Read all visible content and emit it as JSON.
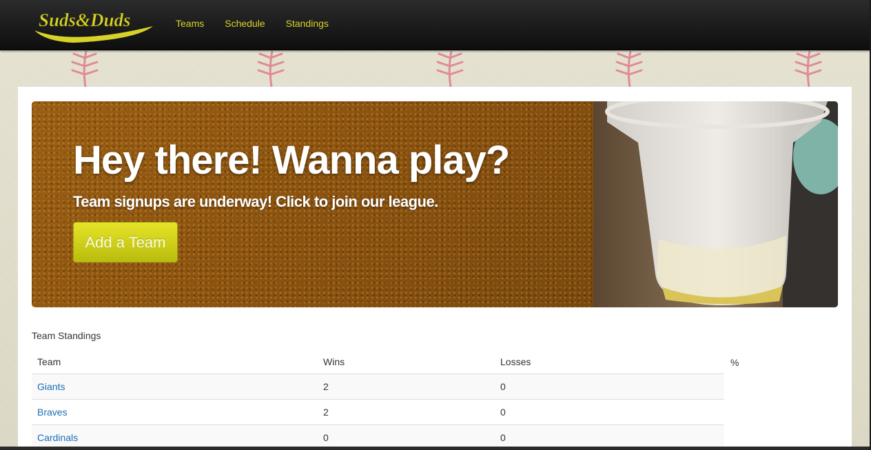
{
  "brand": {
    "name": "Suds&Duds"
  },
  "nav": {
    "items": [
      "Teams",
      "Schedule",
      "Standings"
    ]
  },
  "hero": {
    "title": "Hey there! Wanna play?",
    "subtitle": "Team signups are underway! Click to join our league.",
    "button_label": "Add a Team"
  },
  "standings": {
    "title": "Team Standings",
    "columns": [
      "Team",
      "Wins",
      "Losses",
      "%"
    ],
    "rows": [
      {
        "team": "Giants",
        "wins": "2",
        "losses": "0"
      },
      {
        "team": "Braves",
        "wins": "2",
        "losses": "0"
      },
      {
        "team": "Cardinals",
        "wins": "0",
        "losses": "0"
      }
    ]
  },
  "colors": {
    "navbar": "#1a1a1a",
    "nav_link": "#d8d42a",
    "button": "#cfd11a",
    "link": "#1a6fb5"
  }
}
